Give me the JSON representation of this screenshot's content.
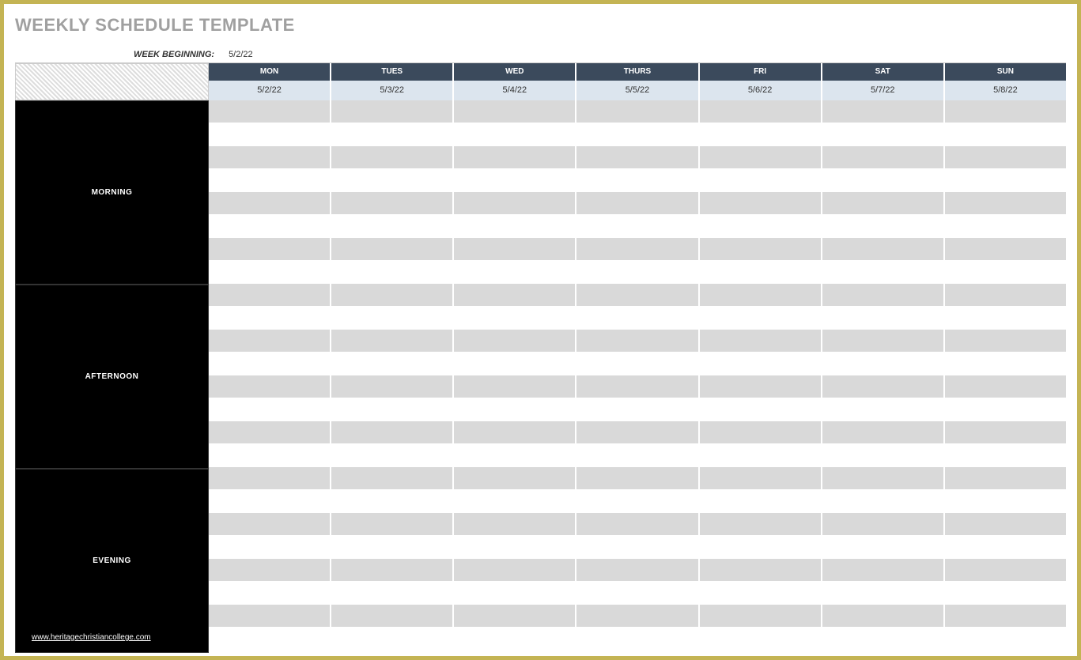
{
  "title": "WEEKLY SCHEDULE TEMPLATE",
  "week_beginning_label": "WEEK BEGINNING:",
  "week_beginning_value": "5/2/22",
  "days": [
    {
      "name": "MON",
      "date": "5/2/22"
    },
    {
      "name": "TUES",
      "date": "5/3/22"
    },
    {
      "name": "WED",
      "date": "5/4/22"
    },
    {
      "name": "THURS",
      "date": "5/5/22"
    },
    {
      "name": "FRI",
      "date": "5/6/22"
    },
    {
      "name": "SAT",
      "date": "5/7/22"
    },
    {
      "name": "SUN",
      "date": "5/8/22"
    }
  ],
  "periods": [
    {
      "label": "MORNING",
      "rows": 8
    },
    {
      "label": "AFTERNOON",
      "rows": 8
    },
    {
      "label": "EVENING",
      "rows": 8
    }
  ],
  "watermark": "www.heritagechristiancollege.com"
}
